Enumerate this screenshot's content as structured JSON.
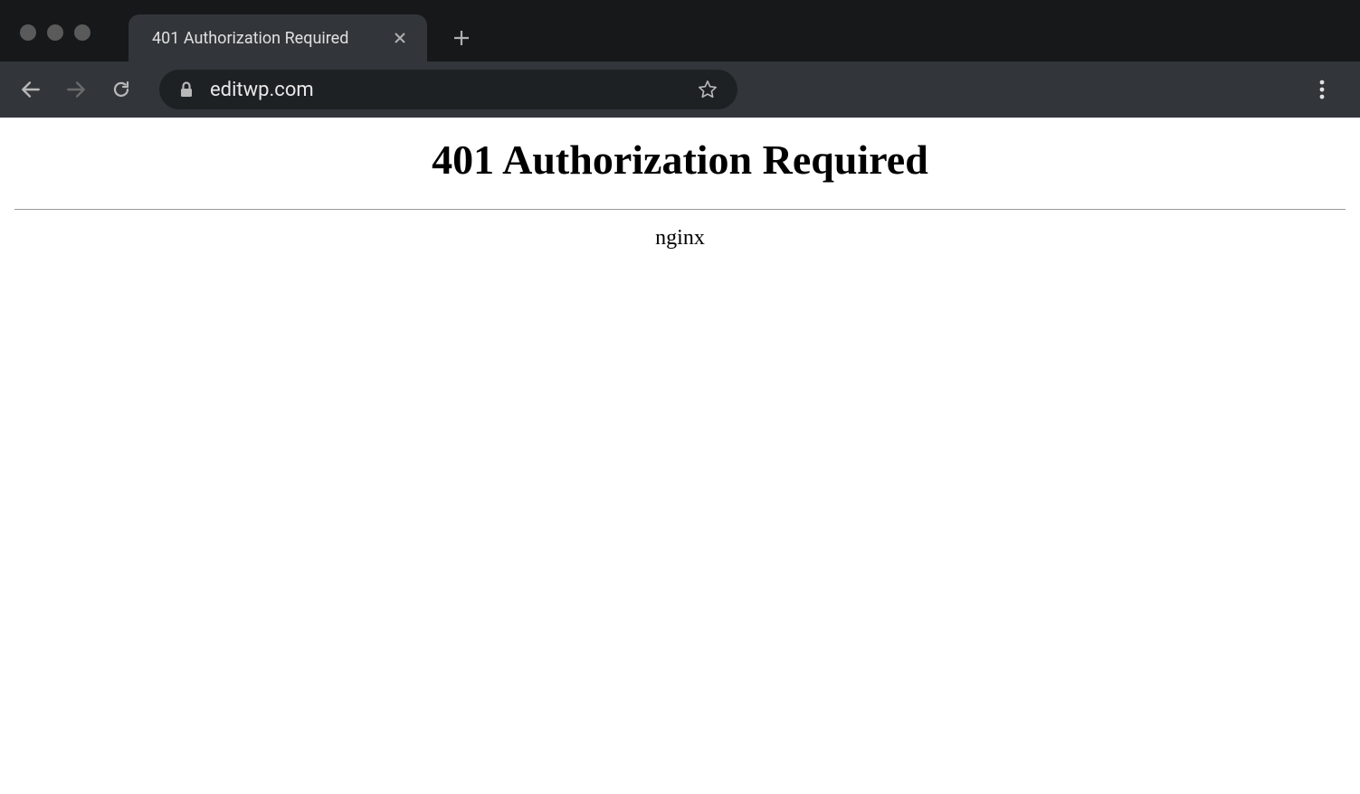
{
  "browser": {
    "tab_title": "401 Authorization Required",
    "url": "editwp.com"
  },
  "page": {
    "heading": "401 Authorization Required",
    "server": "nginx"
  }
}
